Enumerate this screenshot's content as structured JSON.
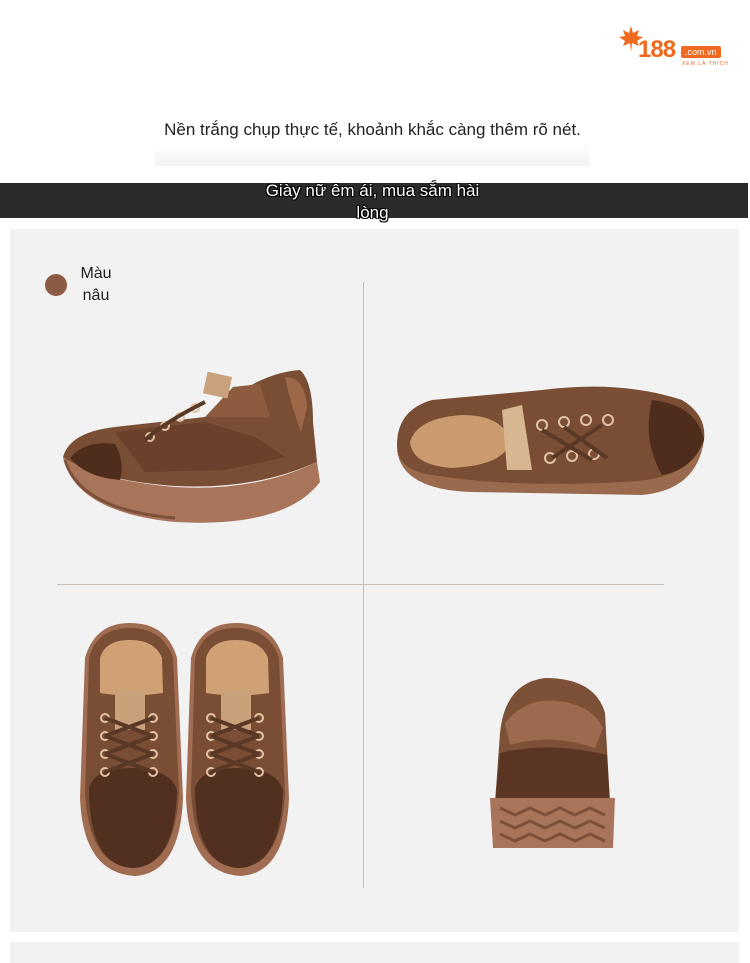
{
  "logo": {
    "number": "188",
    "domain": ".com.vn",
    "tagline": "XEM LÀ THÍCH"
  },
  "intro_text": "Nền trắng chụp thực tế, khoảnh khắc càng thêm rõ nét.",
  "banner_text": "Giày nữ êm ái, mua sắm hài lòng",
  "color_option": {
    "label": "Màu nâu",
    "swatch_color": "#8b5b45"
  },
  "photos": [
    "shoe-side-view",
    "shoe-top-side-view",
    "shoe-pair-front-view",
    "shoe-back-view"
  ],
  "colors": {
    "accent": "#ef6a1f",
    "banner_bg": "#2b2b2b",
    "panel_bg": "#f2f2f2",
    "leather": "#7a4e34",
    "sole": "#a5745a"
  }
}
